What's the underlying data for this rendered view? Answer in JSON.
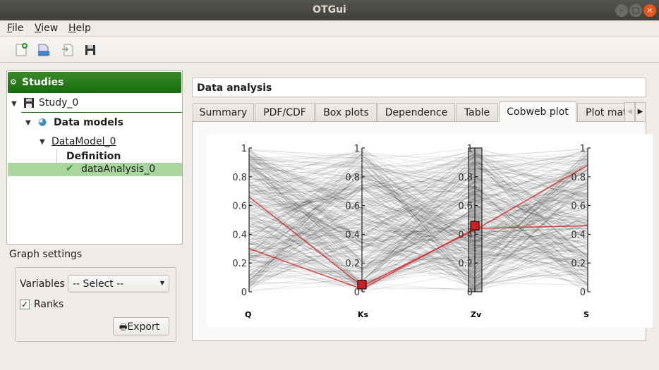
{
  "window": {
    "title": "OTGui"
  },
  "menu": [
    {
      "label": "File",
      "mnemonic": "F",
      "rest": "ile"
    },
    {
      "label": "View",
      "mnemonic": "V",
      "rest": "iew"
    },
    {
      "label": "Help",
      "mnemonic": "H",
      "rest": "elp"
    }
  ],
  "toolbar": {
    "icons": [
      "new-study-icon",
      "open-study-icon",
      "import-icon",
      "save-icon"
    ]
  },
  "tree": {
    "header": "Studies",
    "study": "Study_0",
    "data_models": "Data models",
    "data_model": "DataModel_0",
    "definition": "Definition",
    "analysis": "dataAnalysis_0"
  },
  "graph_settings": {
    "label": "Graph settings",
    "variables_label": "Variables",
    "variables_value": "-- Select --",
    "ranks_label": "Ranks",
    "ranks_checked": true,
    "export_label": "Export"
  },
  "main": {
    "title": "Data analysis",
    "tabs": [
      {
        "label": "Summary"
      },
      {
        "label": "PDF/CDF"
      },
      {
        "label": "Box plots"
      },
      {
        "label": "Dependence"
      },
      {
        "label": "Table"
      },
      {
        "label": "Cobweb plot",
        "active": true
      },
      {
        "label": "Plot mat"
      }
    ]
  },
  "chart_data": {
    "type": "parallel-coordinates",
    "axes": [
      "Q",
      "Ks",
      "Zv",
      "S"
    ],
    "ylim": [
      0,
      1
    ],
    "ticks": [
      "0",
      "0.2",
      "0.4",
      "0.6",
      "0.8",
      "1"
    ],
    "background_line_color": "#000000",
    "highlight_color": "#d62728",
    "highlighted_samples": [
      {
        "Q": 0.66,
        "Ks": 0.04,
        "Zv": 0.43,
        "S": 0.88
      },
      {
        "Q": 0.3,
        "Ks": 0.02,
        "Zv": 0.44,
        "S": 0.46
      }
    ],
    "selections": [
      {
        "axis": "Ks",
        "range": [
          0.02,
          0.08
        ]
      },
      {
        "axis": "Zv",
        "range": [
          0.43,
          0.49
        ]
      }
    ]
  }
}
